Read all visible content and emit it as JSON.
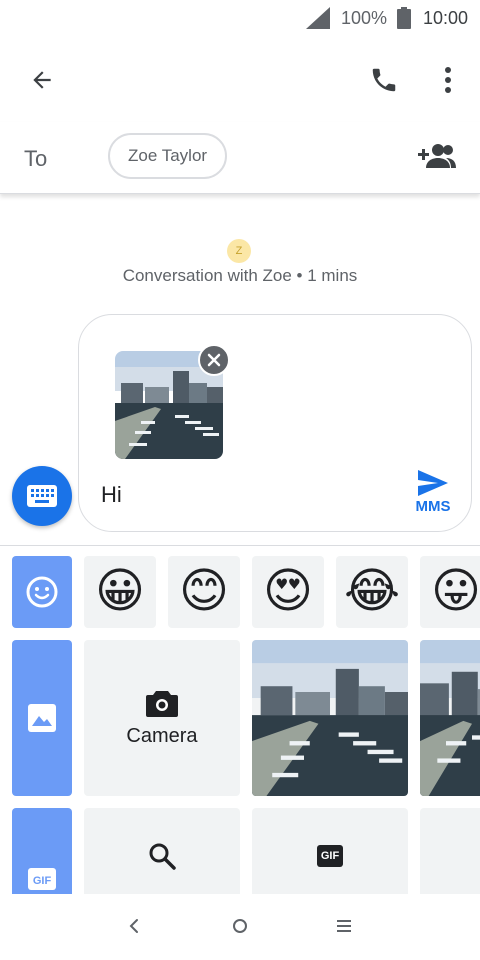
{
  "status_bar": {
    "battery_percent": "100%",
    "time": "10:00",
    "icons": [
      "signal-icon",
      "battery-icon"
    ]
  },
  "app_bar": {
    "icons": [
      "back-arrow-icon",
      "phone-icon",
      "more-vert-icon"
    ]
  },
  "recipient": {
    "to_label": "To",
    "chip_name": "Zoe Taylor",
    "add_icon": "add-people-icon"
  },
  "conversation": {
    "avatar_letter": "Z",
    "info": "Conversation with Zoe • 1 mins"
  },
  "compose": {
    "message_text": "Hi",
    "send_label": "MMS",
    "attachment": "harbor-photo"
  },
  "media_panel": {
    "tabs": [
      "emoji-tab",
      "gallery-tab",
      "gif-tab"
    ],
    "emojis": [
      "😀",
      "😊",
      "😍",
      "😂",
      "😛"
    ],
    "camera_label": "Camera",
    "gif_label": "GIF"
  },
  "colors": {
    "accent": "#1a73e8",
    "tab_blue": "#6b9bf6",
    "tile_grey": "#f1f3f4"
  }
}
